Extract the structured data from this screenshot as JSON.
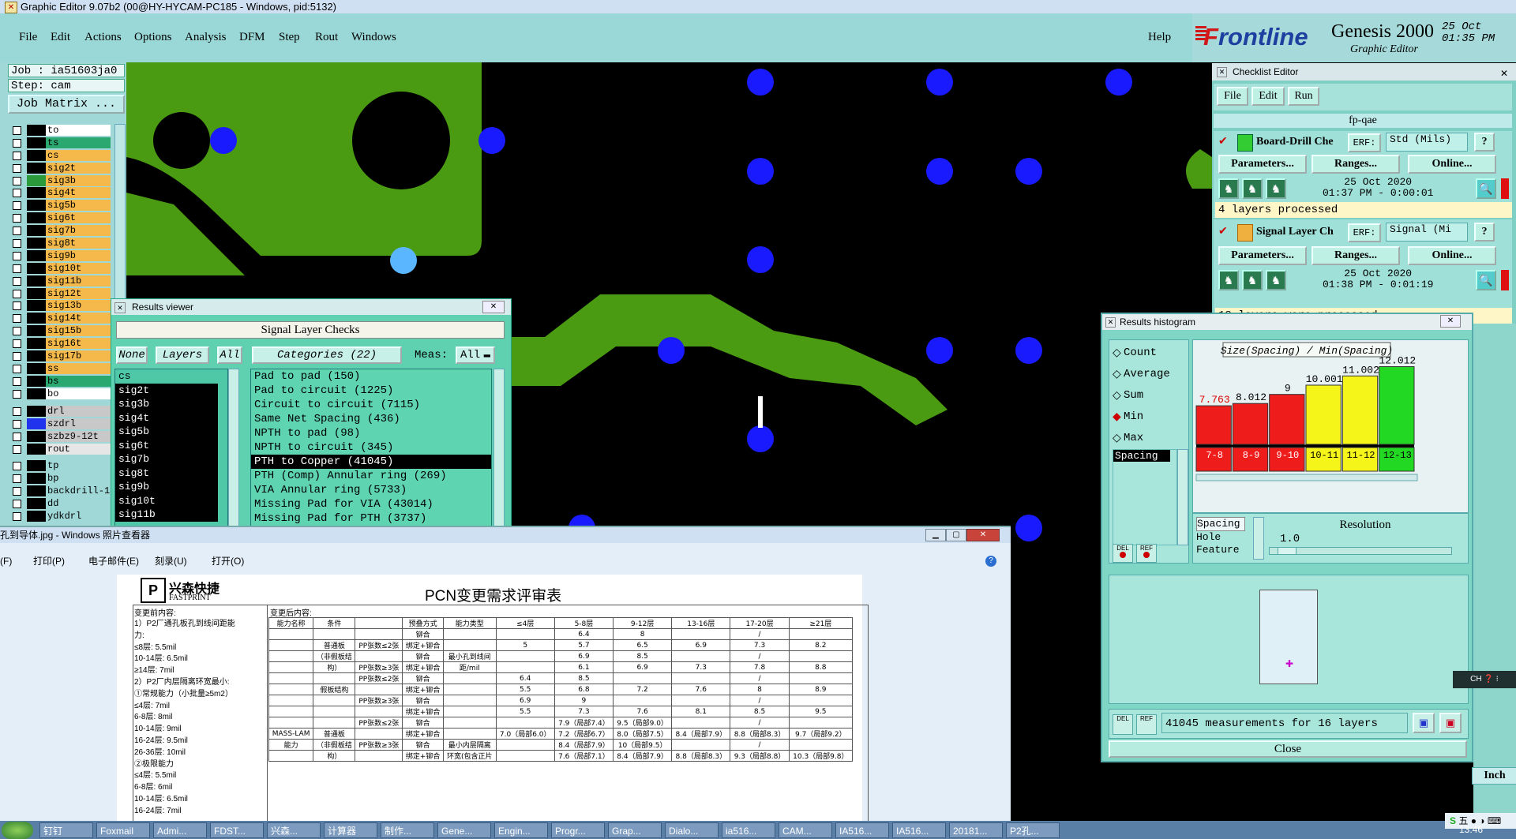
{
  "titlebar": {
    "title": "Graphic Editor 9.07b2 (00@HY-HYCAM-PC185 - Windows, pid:5132)"
  },
  "menu": {
    "items": [
      "File",
      "Edit",
      "Actions",
      "Options",
      "Analysis",
      "DFM",
      "Step",
      "Rout",
      "Windows"
    ],
    "help": "Help"
  },
  "brand": {
    "logo_f": "F",
    "logo_rest": "rontline",
    "product": "Genesis 2000",
    "subtitle": "Graphic Editor",
    "date": "25 Oct",
    "time": "01:35 PM"
  },
  "job": {
    "job": "Job : ia51603ja0",
    "step": "Step: cam",
    "matrix": "Job Matrix ..."
  },
  "layers": [
    {
      "name": "to",
      "color": "#ffffff"
    },
    {
      "name": "ts",
      "color": "#2aa870"
    },
    {
      "name": "cs",
      "color": "#f5b84a"
    },
    {
      "name": "sig2t",
      "color": "#f5b84a"
    },
    {
      "name": "sig3b",
      "color": "#f5b84a"
    },
    {
      "name": "sig4t",
      "color": "#f5b84a"
    },
    {
      "name": "sig5b",
      "color": "#f5b84a"
    },
    {
      "name": "sig6t",
      "color": "#f5b84a"
    },
    {
      "name": "sig7b",
      "color": "#f5b84a"
    },
    {
      "name": "sig8t",
      "color": "#f5b84a"
    },
    {
      "name": "sig9b",
      "color": "#f5b84a"
    },
    {
      "name": "sig10t",
      "color": "#f5b84a"
    },
    {
      "name": "sig11b",
      "color": "#f5b84a"
    },
    {
      "name": "sig12t",
      "color": "#f5b84a"
    },
    {
      "name": "sig13b",
      "color": "#f5b84a"
    },
    {
      "name": "sig14t",
      "color": "#f5b84a"
    },
    {
      "name": "sig15b",
      "color": "#f5b84a"
    },
    {
      "name": "sig16t",
      "color": "#f5b84a"
    },
    {
      "name": "sig17b",
      "color": "#f5b84a"
    },
    {
      "name": "ss",
      "color": "#f5b84a"
    },
    {
      "name": "bs",
      "color": "#2aa870"
    },
    {
      "name": "bo",
      "color": "#ffffff"
    }
  ],
  "drill_layers": [
    {
      "name": "drl",
      "color": "#c8c8c8"
    },
    {
      "name": "szdrl",
      "color": "#c8c8c8"
    },
    {
      "name": "szbz9-12t",
      "color": "#c8c8c8"
    },
    {
      "name": "rout",
      "color": "#e6e6e6"
    }
  ],
  "other_layers": [
    {
      "name": "tp",
      "color": "#a0d8d8"
    },
    {
      "name": "bp",
      "color": "#a0d8d8"
    },
    {
      "name": "backdrill-1",
      "color": "#a0d8d8"
    },
    {
      "name": "dd",
      "color": "#a0d8d8"
    },
    {
      "name": "ydkdrl",
      "color": "#a0d8d8"
    }
  ],
  "results_viewer": {
    "window_title": "Results viewer",
    "title": "Signal Layer Checks",
    "none": "None",
    "layers": "Layers",
    "all": "All",
    "categories": "Categories (22)",
    "meas_label": "Meas:",
    "meas_value": "All",
    "layer_items": [
      "cs",
      "sig2t",
      "sig3b",
      "sig4t",
      "sig5b",
      "sig6t",
      "sig7b",
      "sig8t",
      "sig9b",
      "sig10t",
      "sig11b"
    ],
    "category_items": [
      "Pad to pad (150)",
      "Pad to circuit (1225)",
      "Circuit to circuit (7115)",
      "Same Net Spacing (436)",
      "NPTH to pad (98)",
      "NPTH to circuit (345)",
      "PTH to Copper (41045)",
      "PTH (Comp) Annular ring (269)",
      "VIA Annular ring (5733)",
      "Missing Pad for VIA (43014)",
      "Missing Pad for PTH (3737)"
    ],
    "selected_category": "PTH to Copper (41045)"
  },
  "checklist": {
    "window_title": "Checklist Editor",
    "menu": [
      "File",
      "Edit",
      "Run"
    ],
    "name": "fp-qae",
    "erf_label": "ERF:",
    "params": "Parameters...",
    "ranges": "Ranges...",
    "online": "Online...",
    "items": [
      {
        "name": "Board-Drill Che",
        "erf": "Std (Mils)",
        "date": "25 Oct 2020",
        "time": "01:37 PM - 0:00:01",
        "status": "4 layers processed"
      },
      {
        "name": "Signal Layer Ch",
        "erf": "Signal (Mi",
        "date": "25 Oct 2020",
        "time": "01:38 PM - 0:01:19",
        "status": "18 layers were processed"
      }
    ]
  },
  "histogram": {
    "window_title": "Results histogram",
    "options": [
      "Count",
      "Average",
      "Sum",
      "Min",
      "Max"
    ],
    "selected_option": "Min",
    "list_item": "Spacing",
    "res_items": [
      "Spacing",
      "Hole",
      "Feature"
    ],
    "resolution_label": "Resolution",
    "resolution_value": "1.0",
    "measurements": "41045 measurements for 16 layers",
    "close": "Close",
    "del": "DEL",
    "ref": "REF"
  },
  "chart_data": {
    "type": "bar",
    "title": "Size(Spacing) / Min(Spacing)",
    "categories": [
      "7-8",
      "8-9",
      "9-10",
      "10-11",
      "11-12",
      "12-13"
    ],
    "values": [
      7.763,
      8.012,
      9,
      10.001,
      11.002,
      12.012
    ],
    "value_labels": [
      "7.763",
      "8.012",
      "9",
      "10.001",
      "11.002",
      "12.012"
    ],
    "colors": [
      "#ef1c1c",
      "#ef1c1c",
      "#ef1c1c",
      "#f5f51a",
      "#f5f51a",
      "#22d822"
    ],
    "ylim": [
      0,
      13
    ]
  },
  "photo_viewer": {
    "title": "孔到导体.jpg - Windows 照片查看器",
    "menu": [
      "(F)",
      "打印(P)",
      "电子邮件(E)",
      "刻录(U)",
      "打开(O)"
    ],
    "doc_brand": "兴森快捷",
    "doc_brand_en": "FASTPRINT",
    "doc_title": "PCN变更需求评审表",
    "before_label": "变更前内容:",
    "after_label": "变更后内容:",
    "before_lines": [
      "1）P2厂通孔板孔到线间距能",
      "力:",
      "≤8层: 5.5mil",
      "10-14层: 6.5mil",
      "≥14层: 7mil",
      "2）P2厂内层隔离环宽最小:",
      "①常规能力（小批量≥5m2）",
      "≤4层: 7mil",
      "6-8层: 8mil",
      "10-14层: 9mil",
      "16-24层: 9.5mil",
      "26-36层: 10mil",
      "②极限能力",
      "≤4层: 5.5mil",
      "6-8层: 6mil",
      "10-14层: 6.5mil",
      "16-24层: 7mil"
    ],
    "table_headers": [
      "能力名称",
      "条件",
      "",
      "预叠方式",
      "能力类型",
      "≤4层",
      "5-8层",
      "9-12层",
      "13-16层",
      "17-20层",
      "≥21层"
    ],
    "table_rows": [
      [
        "",
        "",
        "",
        "铆合",
        "",
        "",
        "6.4",
        "8",
        "",
        "/",
        ""
      ],
      [
        "",
        "普通板",
        "PP张数≤2张",
        "绑定+铆合",
        "",
        "5",
        "5.7",
        "6.5",
        "6.9",
        "7.3",
        "8.2"
      ],
      [
        "",
        "（非假板结",
        "",
        "铆合",
        "最小孔到线间",
        "",
        "6.9",
        "8.5",
        "",
        "/",
        ""
      ],
      [
        "",
        "构）",
        "PP张数≥3张",
        "绑定+铆合",
        "距/mil",
        "",
        "6.1",
        "6.9",
        "7.3",
        "7.8",
        "8.8"
      ],
      [
        "",
        "",
        "PP张数≤2张",
        "铆合",
        "",
        "6.4",
        "8.5",
        "",
        "",
        "/",
        ""
      ],
      [
        "",
        "假板结构",
        "",
        "绑定+铆合",
        "",
        "5.5",
        "6.8",
        "7.2",
        "7.6",
        "8",
        "8.9"
      ],
      [
        "",
        "",
        "PP张数≥3张",
        "铆合",
        "",
        "6.9",
        "9",
        "",
        "",
        "/",
        ""
      ],
      [
        "",
        "",
        "",
        "绑定+铆合",
        "",
        "5.5",
        "7.3",
        "7.6",
        "8.1",
        "8.5",
        "9.5"
      ],
      [
        "",
        "",
        "PP张数≤2张",
        "铆合",
        "",
        "",
        "7.9（局部7.4）",
        "9.5（局部9.0）",
        "",
        "/",
        ""
      ],
      [
        "MASS-LAM",
        "普通板",
        "",
        "绑定+铆合",
        "",
        "7.0（局部6.0）",
        "7.2（局部6.7）",
        "8.0（局部7.5）",
        "8.4（局部7.9）",
        "8.8（局部8.3）",
        "9.7（局部9.2）"
      ],
      [
        "能力",
        "（非假板结",
        "PP张数≥3张",
        "铆合",
        "最小内层隔离",
        "",
        "8.4（局部7.9）",
        "10（局部9.5）",
        "",
        "/",
        ""
      ],
      [
        "",
        "构）",
        "",
        "绑定+铆合",
        "环宽(包含正片",
        "",
        "7.6（局部7.1）",
        "8.4（局部7.9）",
        "8.8（局部8.3）",
        "9.3（局部8.8）",
        "10.3（局部9.8）"
      ]
    ]
  },
  "taskbar": {
    "items": [
      "钉钉",
      "Foxmail",
      "Admi...",
      "FDST...",
      "兴森...",
      "计算器",
      "制作...",
      "Gene...",
      "Engin...",
      "Progr...",
      "Grap...",
      "Dialo...",
      "ia516...",
      "CAM...",
      "IA516...",
      "IA516...",
      "20181...",
      "P2孔..."
    ],
    "clock": "13:46",
    "ime": "五",
    "ch": "CH"
  },
  "status": {
    "units": "Inch"
  }
}
